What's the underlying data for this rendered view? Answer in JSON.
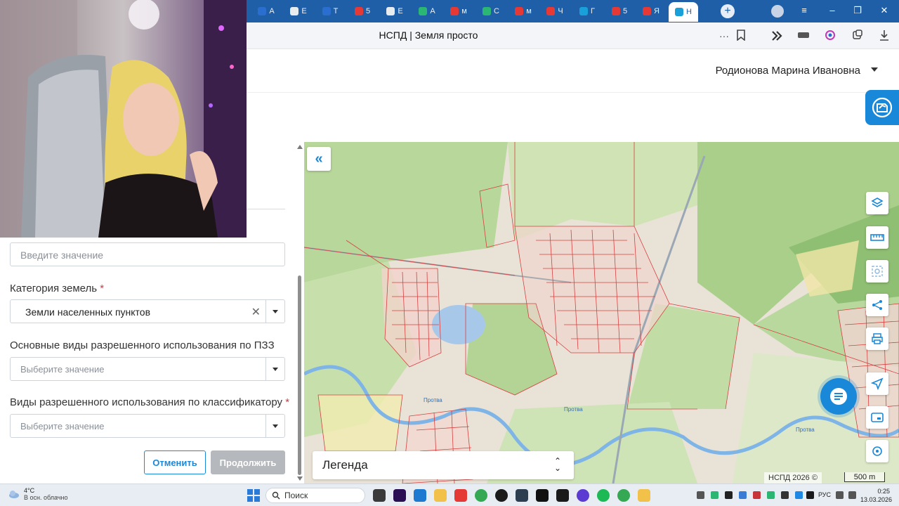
{
  "browser": {
    "tabs": [
      {
        "letter": "А",
        "color": "#2a6fcf"
      },
      {
        "letter": "Е",
        "color": "#e9ecef"
      },
      {
        "letter": "Т",
        "color": "#2a6fcf"
      },
      {
        "letter": "5",
        "color": "#e53935"
      },
      {
        "letter": "Е",
        "color": "#e9ecef"
      },
      {
        "letter": "А",
        "color": "#2bb673"
      },
      {
        "letter": "м",
        "color": "#e53935"
      },
      {
        "letter": "С",
        "color": "#2bb673"
      },
      {
        "letter": "м",
        "color": "#e53935"
      },
      {
        "letter": "Ч",
        "color": "#e53935"
      },
      {
        "letter": "Г",
        "color": "#19a0d8"
      },
      {
        "letter": "5",
        "color": "#e53935"
      },
      {
        "letter": "Я",
        "color": "#e53935"
      },
      {
        "letter": "Н",
        "color": "#19a0d8",
        "active": true
      }
    ],
    "new_tab": "+",
    "page_title": "НСПД | Земля просто",
    "window_controls": [
      "≡",
      "–",
      "❐",
      "✕"
    ],
    "address_icons": [
      "···",
      "bookmark-icon",
      "extension-icon",
      "sidebar-icon",
      "collections-icon",
      "download-icon"
    ]
  },
  "header": {
    "user_name": "Родионова Марина Ивановна",
    "accent_color": "#1a88d9"
  },
  "form": {
    "first_input_placeholder": "Введите значение",
    "land_category": {
      "label": "Категория земель",
      "required": "*",
      "value": "Земли населенных пунктов",
      "clear": "✕"
    },
    "pzz_usage": {
      "label": "Основные виды разрешенного использования по ПЗЗ",
      "placeholder": "Выберите значение"
    },
    "classifier_usage": {
      "label": "Виды разрешенного использования по классификатору",
      "required": "*",
      "placeholder": "Выберите значение"
    },
    "cancel_label": "Отменить",
    "continue_label": "Продолжить"
  },
  "map": {
    "collapse": "«",
    "legend": "Легенда",
    "legend_toggle_up": "⌃",
    "legend_toggle_down": "⌄",
    "copyright": "НСПД 2026 ©",
    "scale": "500 m",
    "river_labels": [
      "Протва",
      "Протва",
      "Протва"
    ],
    "tools": [
      "layers-icon",
      "ruler-icon",
      "area-select-icon",
      "share-icon",
      "print-icon",
      "navigate-icon",
      "minimap-icon",
      "locate-icon"
    ]
  },
  "taskbar": {
    "temperature": "4°C",
    "weather": "В осн. облачно",
    "search_label": "Поиск",
    "language": "РУС",
    "time": "0:25",
    "date": "13.03.2026"
  }
}
